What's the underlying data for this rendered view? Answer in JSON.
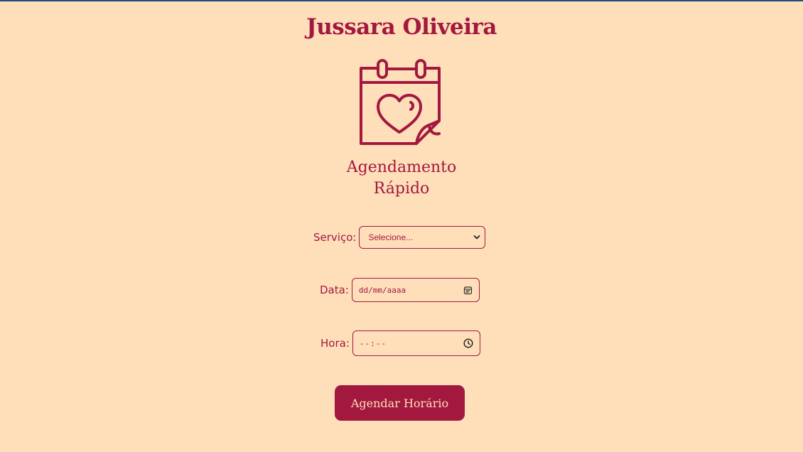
{
  "header": {
    "brand_name": "Jussara Oliveira"
  },
  "hero": {
    "icon": "calendar-heart-icon",
    "subtitle_line1": "Agendamento",
    "subtitle_line2": "Rápido"
  },
  "form": {
    "service": {
      "label": "Serviço:",
      "selected_option": "Selecione..."
    },
    "date": {
      "label": "Data:",
      "placeholder": "dd/mm/aaaa",
      "icon": "calendar-icon"
    },
    "time": {
      "label": "Hora:",
      "placeholder": "--:--",
      "icon": "clock-icon"
    },
    "submit_label": "Agendar Horário"
  },
  "colors": {
    "background": "#FFDFBA",
    "accent": "#A3183F"
  }
}
